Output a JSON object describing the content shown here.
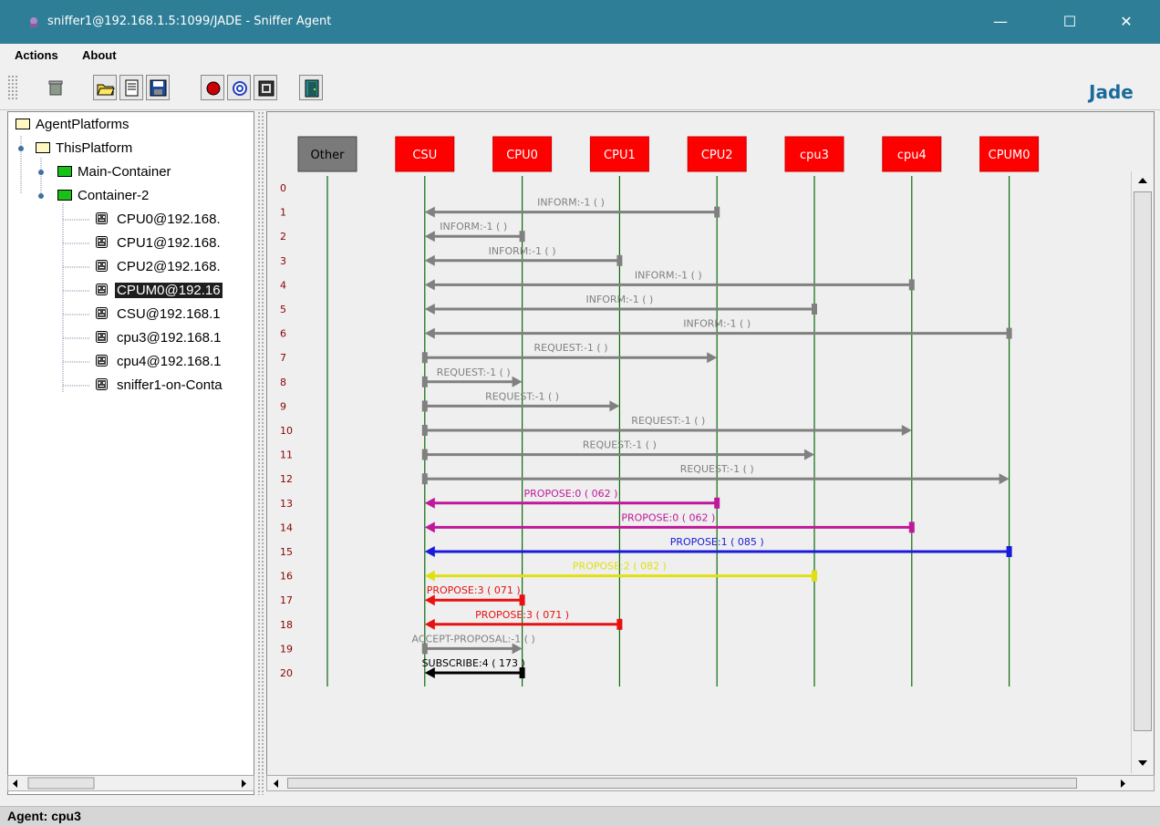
{
  "window": {
    "title": "sniffer1@192.168.1.5:1099/JADE - Sniffer Agent",
    "minimize_glyph": "—",
    "maximize_glyph": "☐",
    "close_glyph": "✕"
  },
  "menu": {
    "items": [
      "Actions",
      "About"
    ]
  },
  "toolbar": {
    "buttons": [
      "clear-canvas-icon",
      "open-file-icon",
      "display-log-icon",
      "save-file-icon",
      "record-icon",
      "message-filter-icon",
      "agent-list-icon",
      "exit-door-icon"
    ],
    "logo_text": "Jade"
  },
  "tree": {
    "root": "AgentPlatforms",
    "platform": "ThisPlatform",
    "containers": [
      "Main-Container",
      "Container-2"
    ],
    "agents": [
      "CPU0@192.168.",
      "CPU1@192.168.",
      "CPU2@192.168.",
      "CPUM0@192.16",
      "CSU@192.168.1",
      "cpu3@192.168.1",
      "cpu4@192.168.1",
      "sniffer1-on-Conta"
    ],
    "selected_agent": "CPUM0@192.16"
  },
  "sniffer": {
    "agents": [
      {
        "name": "Other",
        "style": "gray"
      },
      {
        "name": "CSU",
        "style": "red"
      },
      {
        "name": "CPU0",
        "style": "red"
      },
      {
        "name": "CPU1",
        "style": "red"
      },
      {
        "name": "CPU2",
        "style": "red"
      },
      {
        "name": "cpu3",
        "style": "red"
      },
      {
        "name": "cpu4",
        "style": "red"
      },
      {
        "name": "CPUM0",
        "style": "red"
      }
    ],
    "message_colors": {
      "INFORM": "#808080",
      "REQUEST": "#808080",
      "PROPOSE0": "#c0189a",
      "PROPOSE1": "#1a1adb",
      "PROPOSE2": "#e0e010",
      "PROPOSE3": "#e81010",
      "ACCEPT": "#808080",
      "SUBSCRIBE": "#000000"
    },
    "messages": [
      {
        "n": 0,
        "from": "",
        "to": "",
        "label": "",
        "color": ""
      },
      {
        "n": 1,
        "from": "CPU2",
        "to": "CSU",
        "label": "INFORM:-1 (       )",
        "color": "INFORM"
      },
      {
        "n": 2,
        "from": "CPU0",
        "to": "CSU",
        "label": "INFORM:-1 (       )",
        "color": "INFORM"
      },
      {
        "n": 3,
        "from": "CPU1",
        "to": "CSU",
        "label": "INFORM:-1 (       )",
        "color": "INFORM"
      },
      {
        "n": 4,
        "from": "cpu4",
        "to": "CSU",
        "label": "INFORM:-1 (       )",
        "color": "INFORM"
      },
      {
        "n": 5,
        "from": "cpu3",
        "to": "CSU",
        "label": "INFORM:-1 (       )",
        "color": "INFORM"
      },
      {
        "n": 6,
        "from": "CPUM0",
        "to": "CSU",
        "label": "INFORM:-1 (       )",
        "color": "INFORM"
      },
      {
        "n": 7,
        "from": "CSU",
        "to": "CPU2",
        "label": "REQUEST:-1 (       )",
        "color": "REQUEST"
      },
      {
        "n": 8,
        "from": "CSU",
        "to": "CPU0",
        "label": "REQUEST:-1 (       )",
        "color": "REQUEST"
      },
      {
        "n": 9,
        "from": "CSU",
        "to": "CPU1",
        "label": "REQUEST:-1 (       )",
        "color": "REQUEST"
      },
      {
        "n": 10,
        "from": "CSU",
        "to": "cpu4",
        "label": "REQUEST:-1 (       )",
        "color": "REQUEST"
      },
      {
        "n": 11,
        "from": "CSU",
        "to": "cpu3",
        "label": "REQUEST:-1 (       )",
        "color": "REQUEST"
      },
      {
        "n": 12,
        "from": "CSU",
        "to": "CPUM0",
        "label": "REQUEST:-1 (       )",
        "color": "REQUEST"
      },
      {
        "n": 13,
        "from": "CPU2",
        "to": "CSU",
        "label": "PROPOSE:0 (  062   )",
        "color": "PROPOSE0"
      },
      {
        "n": 14,
        "from": "cpu4",
        "to": "CSU",
        "label": "PROPOSE:0 (  062   )",
        "color": "PROPOSE0"
      },
      {
        "n": 15,
        "from": "CPUM0",
        "to": "CSU",
        "label": "PROPOSE:1 (  085   )",
        "color": "PROPOSE1"
      },
      {
        "n": 16,
        "from": "cpu3",
        "to": "CSU",
        "label": "PROPOSE:2 (  082   )",
        "color": "PROPOSE2"
      },
      {
        "n": 17,
        "from": "CPU0",
        "to": "CSU",
        "label": "PROPOSE:3 (  071   )",
        "color": "PROPOSE3"
      },
      {
        "n": 18,
        "from": "CPU1",
        "to": "CSU",
        "label": "PROPOSE:3 (  071   )",
        "color": "PROPOSE3"
      },
      {
        "n": 19,
        "from": "CSU",
        "to": "CPU0",
        "label": "ACCEPT-PROPOSAL:-1 (       )",
        "color": "ACCEPT"
      },
      {
        "n": 20,
        "from": "CPU0",
        "to": "CSU",
        "label": "SUBSCRIBE:4 (  173   )",
        "color": "SUBSCRIBE"
      }
    ]
  },
  "status": {
    "text": "Agent: cpu3"
  }
}
